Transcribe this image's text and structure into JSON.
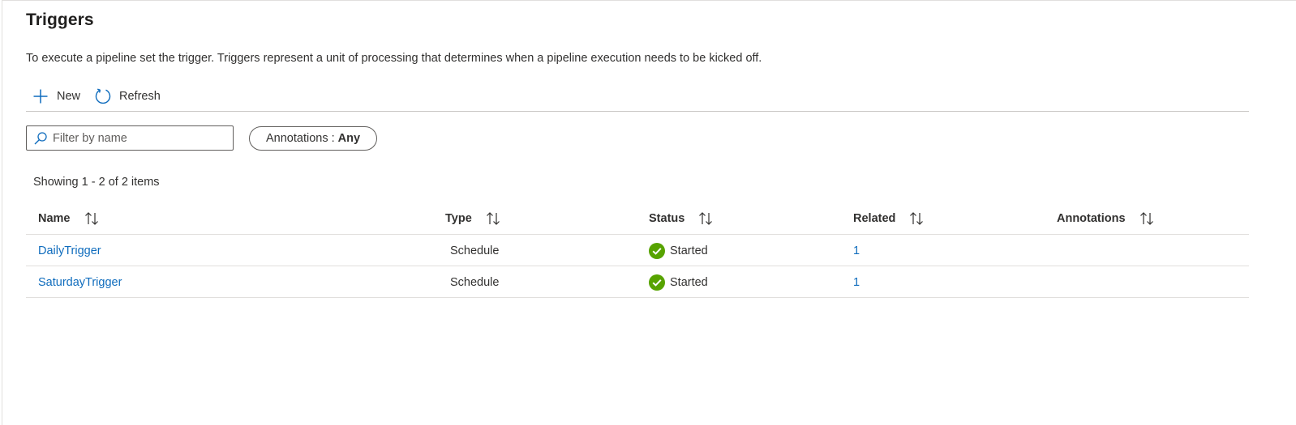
{
  "page": {
    "title": "Triggers",
    "description": "To execute a pipeline set the trigger. Triggers represent a unit of processing that determines when a pipeline execution needs to be kicked off."
  },
  "toolbar": {
    "new_label": "New",
    "refresh_label": "Refresh"
  },
  "filter": {
    "placeholder": "Filter by name",
    "annotations_label": "Annotations :",
    "annotations_value": "Any"
  },
  "summary": "Showing 1 - 2 of 2 items",
  "table": {
    "columns": [
      "Name",
      "Type",
      "Status",
      "Related",
      "Annotations"
    ],
    "rows": [
      {
        "name": "DailyTrigger",
        "type": "Schedule",
        "status": "Started",
        "related": "1",
        "annotations": ""
      },
      {
        "name": "SaturdayTrigger",
        "type": "Schedule",
        "status": "Started",
        "related": "1",
        "annotations": ""
      }
    ]
  },
  "colors": {
    "accent": "#0f6cbd",
    "success": "#57a300",
    "text": "#323130",
    "divider": "#e1dfdd"
  },
  "icons": {
    "new": "add-icon",
    "refresh": "refresh-icon",
    "search": "search-icon",
    "sort": "sort-icon",
    "status": "success-check-icon"
  }
}
